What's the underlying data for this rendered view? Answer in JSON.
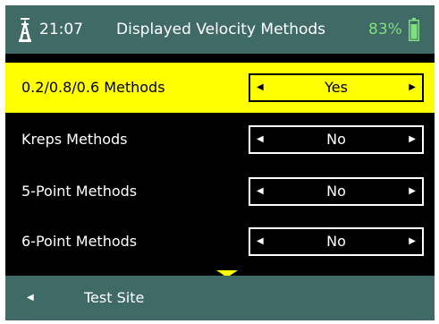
{
  "header": {
    "signal_icon": "signal-tower-icon",
    "time": "21:07",
    "title": "Displayed Velocity Methods",
    "battery_percent": "83%",
    "battery_icon": "battery-icon",
    "battery_color": "#7fe07f"
  },
  "rows": [
    {
      "label": "0.2/0.8/0.6 Methods",
      "value": "Yes",
      "selected": true
    },
    {
      "label": "Kreps Methods",
      "value": "No",
      "selected": false
    },
    {
      "label": "5-Point Methods",
      "value": "No",
      "selected": false
    },
    {
      "label": "6-Point Methods",
      "value": "No",
      "selected": false
    }
  ],
  "selector": {
    "left_arrow": "◀",
    "right_arrow": "▶"
  },
  "scroll_indicator_icon": "chevron-down-icon",
  "footer": {
    "back_arrow": "◀",
    "back_label": "Test Site"
  },
  "colors": {
    "header_bg": "#3f6a66",
    "highlight": "#ffff00",
    "background": "#000000"
  }
}
